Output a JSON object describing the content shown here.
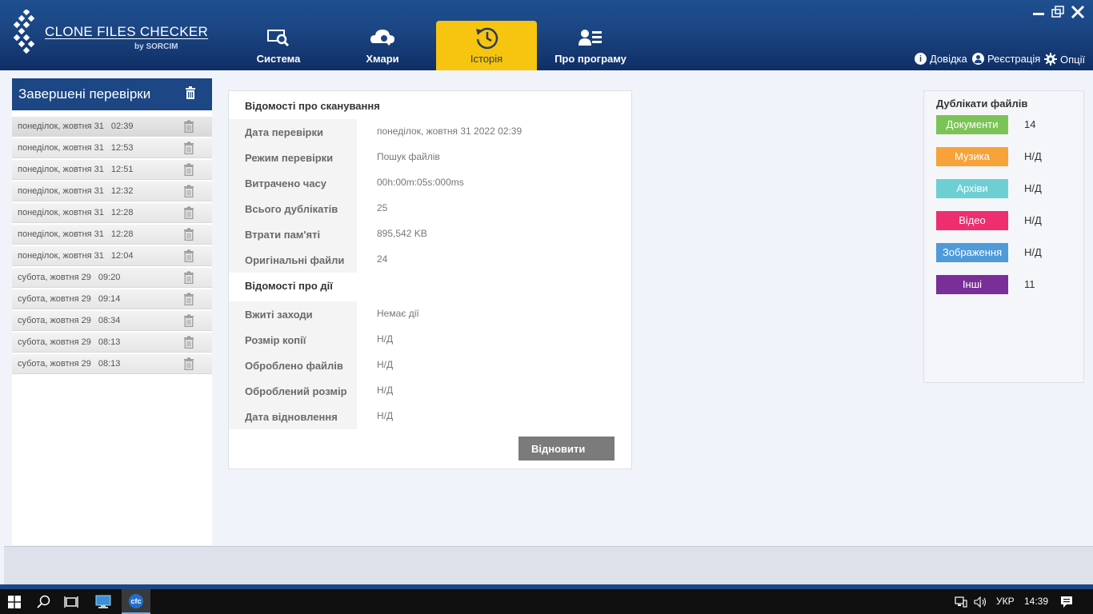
{
  "app": {
    "logo_title": "CLONE FILES CHECKER",
    "logo_sub": "by SORCIM"
  },
  "nav": {
    "tabs": [
      {
        "label": "Система",
        "icon": "monitor-search-icon"
      },
      {
        "label": "Хмари",
        "icon": "cloud-search-icon"
      },
      {
        "label": "Історія",
        "icon": "history-icon",
        "active": true
      },
      {
        "label": "Про програму",
        "icon": "user-card-icon"
      }
    ],
    "links": {
      "help": "Довідка",
      "register": "Реєстрація",
      "options": "Опції"
    }
  },
  "colors": {
    "accent": "#f7c40f",
    "header": "#1c4684",
    "documents": "#7cc357",
    "music": "#f8a23a",
    "archives": "#6dcfd3",
    "video": "#ee2e6f",
    "images": "#4f9ad8",
    "other": "#7a2e97"
  },
  "history": {
    "title": "Завершені перевірки",
    "items": [
      {
        "day": "понеділок, жовтня 31",
        "time": "02:39"
      },
      {
        "day": "понеділок, жовтня 31",
        "time": "12:53"
      },
      {
        "day": "понеділок, жовтня 31",
        "time": "12:51"
      },
      {
        "day": "понеділок, жовтня 31",
        "time": "12:32"
      },
      {
        "day": "понеділок, жовтня 31",
        "time": "12:28"
      },
      {
        "day": "понеділок, жовтня 31",
        "time": "12:28"
      },
      {
        "day": "понеділок, жовтня 31",
        "time": "12:04"
      },
      {
        "day": "субота, жовтня 29",
        "time": "09:20"
      },
      {
        "day": "субота, жовтня 29",
        "time": "09:14"
      },
      {
        "day": "субота, жовтня 29",
        "time": "08:34"
      },
      {
        "day": "субота, жовтня 29",
        "time": "08:13"
      },
      {
        "day": "субота, жовтня 29",
        "time": "08:13"
      }
    ]
  },
  "scan_info": {
    "title": "Відомості про сканування",
    "rows": [
      {
        "key": "Дата перевірки",
        "value": "понеділок, жовтня 31 2022  02:39"
      },
      {
        "key": "Режим перевірки",
        "value": "Пошук файлів"
      },
      {
        "key": "Витрачено часу",
        "value": "00h:00m:05s:000ms"
      },
      {
        "key": "Всього дублікатів",
        "value": "25"
      },
      {
        "key": "Втрати пам'яті",
        "value": "895,542 KB"
      },
      {
        "key": "Оригінальні файли",
        "value": "24"
      }
    ]
  },
  "action_info": {
    "title": "Відомості про дії",
    "rows": [
      {
        "key": "Вжиті заходи",
        "value": "Немає дії"
      },
      {
        "key": "Розмір копії",
        "value": "Н/Д"
      },
      {
        "key": "Оброблено файлів",
        "value": "Н/Д"
      },
      {
        "key": "Оброблений розмір",
        "value": "Н/Д"
      },
      {
        "key": "Дата відновлення",
        "value": "Н/Д"
      }
    ],
    "restore_label": "Відновити"
  },
  "duplicates": {
    "title": "Дублікати файлів",
    "categories": [
      {
        "label": "Документи",
        "count": "14"
      },
      {
        "label": "Музика",
        "count": "Н/Д"
      },
      {
        "label": "Архіви",
        "count": "Н/Д"
      },
      {
        "label": "Відео",
        "count": "Н/Д"
      },
      {
        "label": "Зображення",
        "count": "Н/Д"
      },
      {
        "label": "Інші",
        "count": "11"
      }
    ]
  },
  "taskbar": {
    "lang": "УКР",
    "time": "14:39",
    "app_label": "cfc"
  }
}
